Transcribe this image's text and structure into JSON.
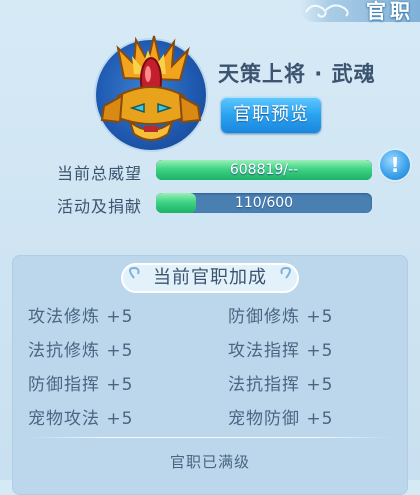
{
  "window": {
    "title": "官职"
  },
  "rank": {
    "name": "天策上将 · 武魂",
    "preview_label": "官职预览",
    "emblem_icon": "golden-helmet-icon"
  },
  "stats": {
    "prestige": {
      "label": "当前总威望",
      "text": "608819/--",
      "fill": 1.0
    },
    "activity": {
      "label": "活动及捐献",
      "text": "110/600",
      "fill": 0.183
    },
    "info_icon": "exclamation-icon",
    "info_text": "!"
  },
  "bonus": {
    "title": "当前官职加成",
    "items": [
      "攻法修炼 +5",
      "防御修炼 +5",
      "法抗修炼 +5",
      "攻法指挥 +5",
      "防御指挥 +5",
      "法抗指挥 +5",
      "宠物攻法 +5",
      "宠物防御 +5"
    ],
    "status": "官职已满级"
  },
  "colors": {
    "accent": "#2aa2f0",
    "bar_fill": "#3fd384",
    "bar_track": "#4a7fb2",
    "text": "#3d5470"
  }
}
